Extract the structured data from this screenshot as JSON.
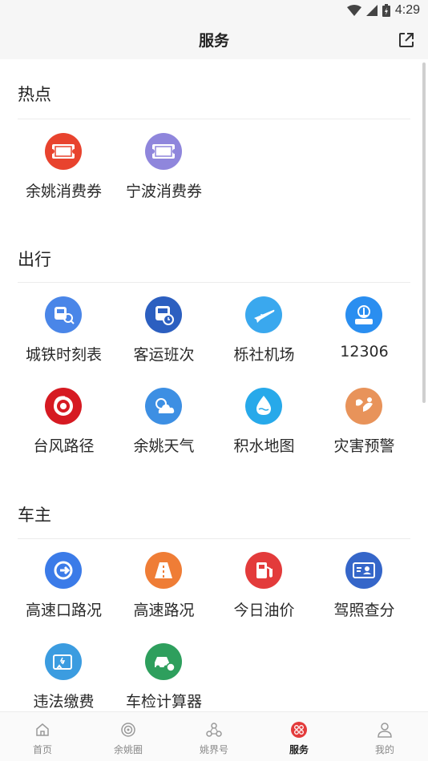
{
  "status_bar": {
    "time": "4:29"
  },
  "header": {
    "title": "服务"
  },
  "sections": [
    {
      "title": "热点",
      "items": [
        {
          "label": "余姚消费券",
          "icon": "coupon-icon",
          "color": "#e8432e"
        },
        {
          "label": "宁波消费券",
          "icon": "coupon-icon",
          "color": "#8f86dc"
        }
      ]
    },
    {
      "title": "出行",
      "items": [
        {
          "label": "城铁时刻表",
          "icon": "train-schedule-icon",
          "color": "#4a86e8"
        },
        {
          "label": "客运班次",
          "icon": "bus-icon",
          "color": "#2c5fc0"
        },
        {
          "label": "栎社机场",
          "icon": "airplane-icon",
          "color": "#3aa8ee"
        },
        {
          "label": "12306",
          "icon": "railway-12306-icon",
          "color": "#2a8ef0"
        },
        {
          "label": "台风路径",
          "icon": "typhoon-icon",
          "color": "#d61a22"
        },
        {
          "label": "余姚天气",
          "icon": "weather-icon",
          "color": "#3d8fe3"
        },
        {
          "label": "积水地图",
          "icon": "water-drop-icon",
          "color": "#27a9ea"
        },
        {
          "label": "灾害预警",
          "icon": "disaster-warning-icon",
          "color": "#e8935a"
        }
      ]
    },
    {
      "title": "车主",
      "items": [
        {
          "label": "高速口路况",
          "icon": "highway-exit-icon",
          "color": "#3b7be8"
        },
        {
          "label": "高速路况",
          "icon": "road-icon",
          "color": "#ef7d36"
        },
        {
          "label": "今日油价",
          "icon": "fuel-pump-icon",
          "color": "#e33b3b"
        },
        {
          "label": "驾照查分",
          "icon": "license-icon",
          "color": "#3566c9"
        },
        {
          "label": "违法缴费",
          "icon": "payment-icon",
          "color": "#3b9ce0"
        },
        {
          "label": "车检计算器",
          "icon": "car-inspection-icon",
          "color": "#2e9f5d"
        }
      ]
    }
  ],
  "tabbar": {
    "active_index": 3,
    "tabs": [
      {
        "label": "首页",
        "icon": "home-icon"
      },
      {
        "label": "余姚圈",
        "icon": "circle-icon"
      },
      {
        "label": "姚界号",
        "icon": "hub-icon"
      },
      {
        "label": "服务",
        "icon": "service-icon"
      },
      {
        "label": "我的",
        "icon": "profile-icon"
      }
    ]
  },
  "colors": {
    "accent": "#e33b3b",
    "background": "#ffffff",
    "header_bg": "#f6f6f6"
  }
}
